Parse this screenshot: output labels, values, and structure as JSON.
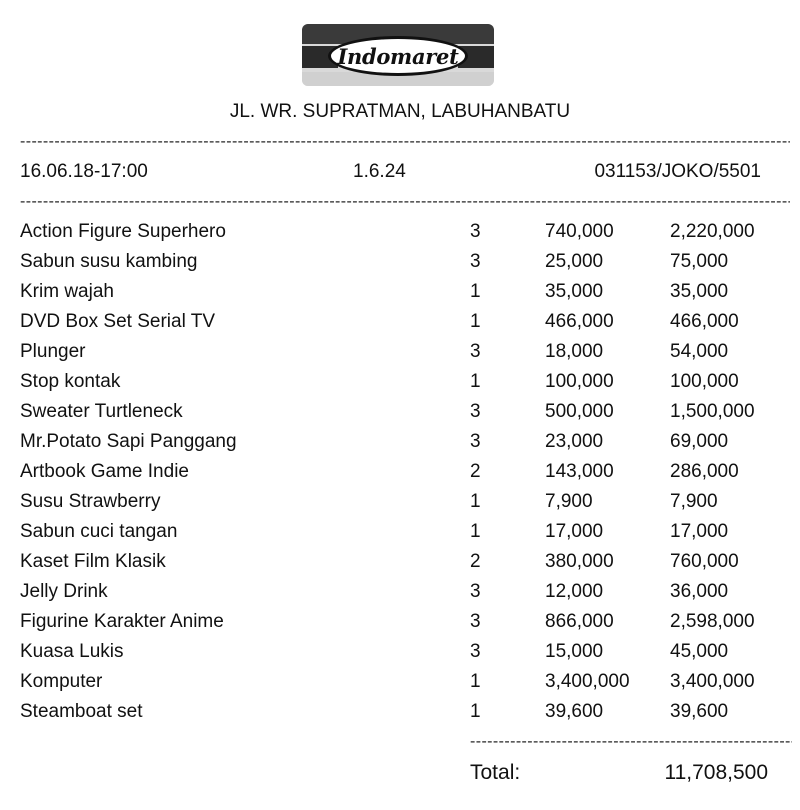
{
  "store": {
    "logo_text": "Indomaret",
    "address": "JL. WR. SUPRATMAN, LABUHANBATU"
  },
  "header": {
    "datetime": "16.06.18-17:00",
    "version": "1.6.24",
    "transaction_id": "031153/JOKO/5501"
  },
  "separator": "------------------------------------------------------------------------------------------------------------------------------------------------------",
  "items": [
    {
      "name": "Action Figure Superhero",
      "qty": "3",
      "price": "740,000",
      "subtotal": "2,220,000"
    },
    {
      "name": "Sabun susu kambing",
      "qty": "3",
      "price": "25,000",
      "subtotal": "75,000"
    },
    {
      "name": "Krim wajah",
      "qty": "1",
      "price": "35,000",
      "subtotal": "35,000"
    },
    {
      "name": "DVD Box Set Serial TV",
      "qty": "1",
      "price": "466,000",
      "subtotal": "466,000"
    },
    {
      "name": "Plunger",
      "qty": "3",
      "price": "18,000",
      "subtotal": "54,000"
    },
    {
      "name": "Stop kontak",
      "qty": "1",
      "price": "100,000",
      "subtotal": "100,000"
    },
    {
      "name": "Sweater Turtleneck",
      "qty": "3",
      "price": "500,000",
      "subtotal": "1,500,000"
    },
    {
      "name": "Mr.Potato Sapi Panggang",
      "qty": "3",
      "price": "23,000",
      "subtotal": "69,000"
    },
    {
      "name": "Artbook Game Indie",
      "qty": "2",
      "price": "143,000",
      "subtotal": "286,000"
    },
    {
      "name": "Susu Strawberry",
      "qty": "1",
      "price": "7,900",
      "subtotal": "7,900"
    },
    {
      "name": "Sabun cuci tangan",
      "qty": "1",
      "price": "17,000",
      "subtotal": "17,000"
    },
    {
      "name": "Kaset Film Klasik",
      "qty": "2",
      "price": "380,000",
      "subtotal": "760,000"
    },
    {
      "name": "Jelly Drink",
      "qty": "3",
      "price": "12,000",
      "subtotal": "36,000"
    },
    {
      "name": "Figurine Karakter Anime",
      "qty": "3",
      "price": "866,000",
      "subtotal": "2,598,000"
    },
    {
      "name": "Kuasa Lukis",
      "qty": "3",
      "price": "15,000",
      "subtotal": "45,000"
    },
    {
      "name": "Komputer",
      "qty": "1",
      "price": "3,400,000",
      "subtotal": "3,400,000"
    },
    {
      "name": "Steamboat set",
      "qty": "1",
      "price": "39,600",
      "subtotal": "39,600"
    }
  ],
  "total": {
    "label": "Total:",
    "value": "11,708,500"
  }
}
